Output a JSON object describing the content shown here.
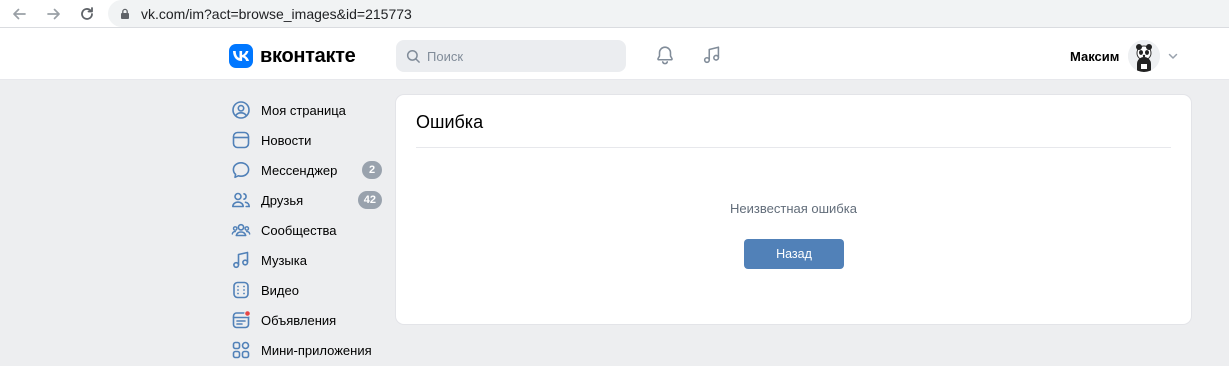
{
  "browser": {
    "url": "vk.com/im?act=browse_images&id=215773",
    "icons": [
      "back-arrow-icon",
      "forward-arrow-icon",
      "reload-icon",
      "lock-icon"
    ]
  },
  "header": {
    "logo_text": "вконтакте",
    "search_placeholder": "Поиск",
    "user_name": "Максим",
    "colors": {
      "brand": "#0077ff",
      "accent": "#5181b8"
    }
  },
  "sidebar": {
    "items": [
      {
        "label": "Моя страница",
        "icon": "user-circle-icon"
      },
      {
        "label": "Новости",
        "icon": "newsfeed-icon"
      },
      {
        "label": "Мессенджер",
        "icon": "message-bubble-icon",
        "badge": "2"
      },
      {
        "label": "Друзья",
        "icon": "friends-icon",
        "badge": "42"
      },
      {
        "label": "Сообщества",
        "icon": "communities-icon"
      },
      {
        "label": "Музыка",
        "icon": "music-note-icon"
      },
      {
        "label": "Видео",
        "icon": "video-icon"
      },
      {
        "label": "Объявления",
        "icon": "classifieds-icon"
      },
      {
        "label": "Мини-приложения",
        "icon": "mini-apps-icon"
      }
    ]
  },
  "main": {
    "title": "Ошибка",
    "message": "Неизвестная ошибка",
    "back_label": "Назад"
  }
}
